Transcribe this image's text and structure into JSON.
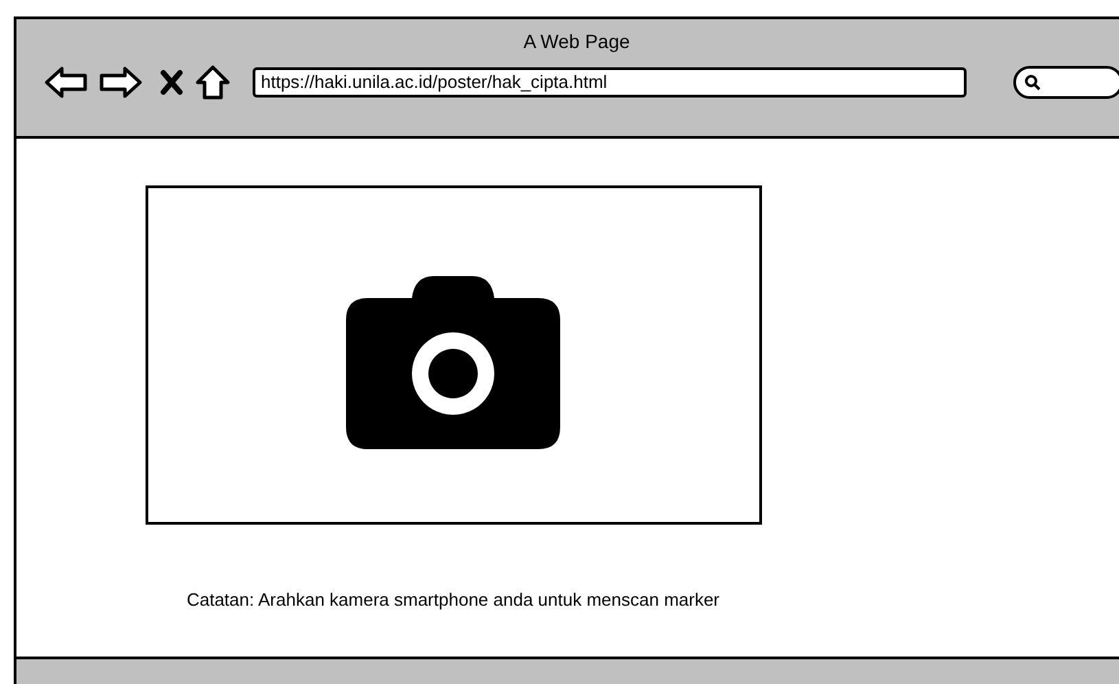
{
  "window": {
    "title": "A Web Page"
  },
  "address_bar": {
    "value": "https://haki.unila.ac.id/poster/hak_cipta.html"
  },
  "note": "Catatan: Arahkan kamera smartphone anda untuk menscan marker"
}
